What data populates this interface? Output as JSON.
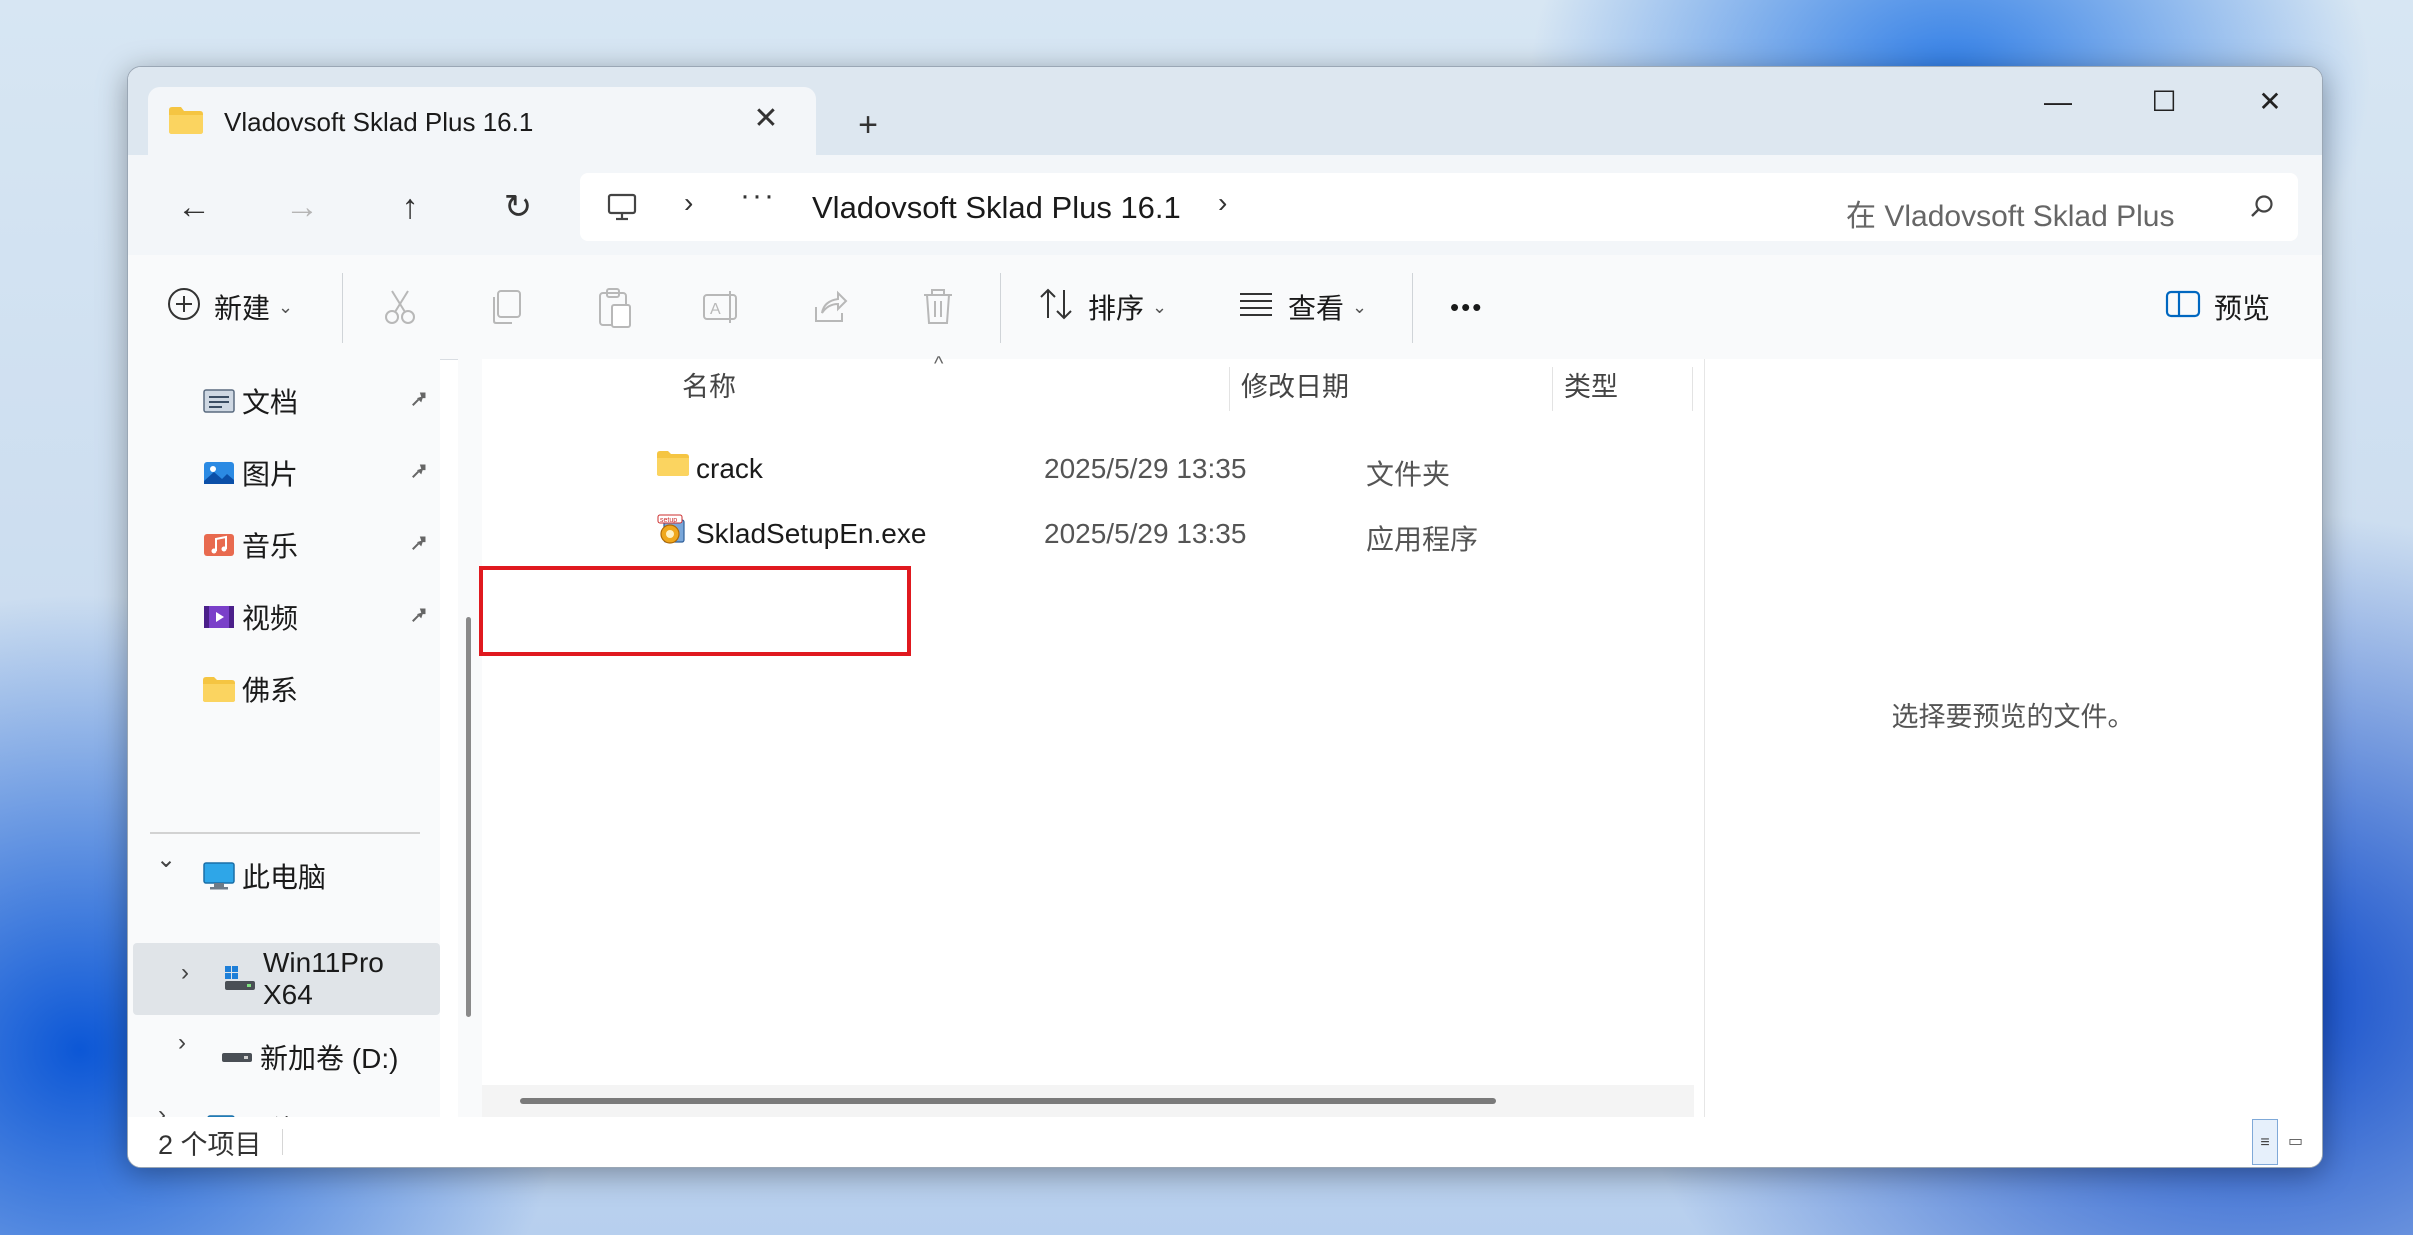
{
  "window": {
    "tab_title": "Vladovsoft  Sklad Plus 16.1",
    "tab_close": "✕",
    "new_tab": "+",
    "minimize": "—",
    "maximize": "☐",
    "close": "✕"
  },
  "addressbar": {
    "back": "←",
    "forward": "→",
    "up": "↑",
    "refresh": "↻",
    "sep": "›",
    "overflow": "···",
    "path": "Vladovsoft  Sklad Plus 16.1",
    "search_placeholder": "在 Vladovsoft  Sklad Plus"
  },
  "toolbar": {
    "new_label": "新建",
    "sort_label": "排序",
    "view_label": "查看",
    "more_label": "•••",
    "preview_label": "预览",
    "caret": "⌄"
  },
  "sidebar": {
    "quick_access": [
      {
        "label": "文档",
        "icon": "documents-icon",
        "pinned": true
      },
      {
        "label": "图片",
        "icon": "pictures-icon",
        "pinned": true
      },
      {
        "label": "音乐",
        "icon": "music-icon",
        "pinned": true
      },
      {
        "label": "视频",
        "icon": "videos-icon",
        "pinned": true
      },
      {
        "label": "佛系",
        "icon": "folder-icon",
        "pinned": false
      }
    ],
    "this_pc": "此电脑",
    "drive_c": "Win11Pro X64",
    "drive_d": "新加卷 (D:)",
    "network": "网络",
    "pin_glyph": "📌",
    "expand_open": "⌄",
    "expand_closed": "›"
  },
  "file_list": {
    "columns": {
      "name": "名称",
      "date": "修改日期",
      "type": "类型"
    },
    "sort_indicator": "^",
    "rows": [
      {
        "name": "crack",
        "date": "2025/5/29 13:35",
        "type": "文件夹",
        "icon": "folder-icon"
      },
      {
        "name": "SkladSetupEn.exe",
        "date": "2025/5/29 13:35",
        "type": "应用程序",
        "icon": "setup-exe-icon"
      }
    ]
  },
  "preview": {
    "empty_text": "选择要预览的文件。"
  },
  "status": {
    "item_count": "2 个项目",
    "details_view": "≡",
    "tiles_view": "▭"
  },
  "colors": {
    "highlight_box": "#e0191f",
    "folder_yellow": "#f5c542",
    "accent_blue": "#0067c0"
  }
}
